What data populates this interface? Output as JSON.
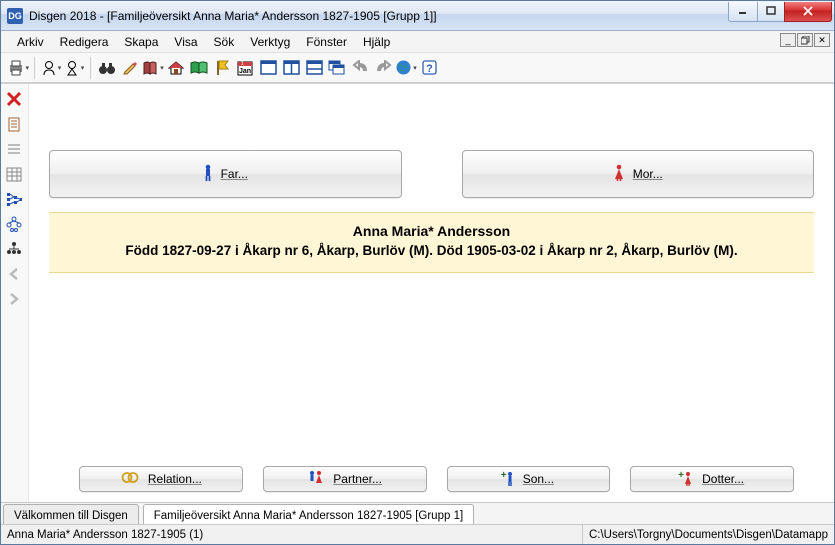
{
  "titlebar": {
    "app_icon": "DG",
    "title": "Disgen 2018 - [Familjeöversikt Anna Maria* Andersson 1827-1905 [Grupp 1]]"
  },
  "menu": {
    "items": [
      "Arkiv",
      "Redigera",
      "Skapa",
      "Visa",
      "Sök",
      "Verktyg",
      "Fönster",
      "Hjälp"
    ]
  },
  "parents": {
    "father_label": "Far...",
    "mother_label": "Mor..."
  },
  "person": {
    "name": "Anna Maria* Andersson",
    "info": "Född 1827-09-27 i Åkarp nr 6, Åkarp, Burlöv (M). Död 1905-03-02 i Åkarp nr 2, Åkarp, Burlöv (M)."
  },
  "actions": {
    "relation": "Relation...",
    "partner": "Partner...",
    "son": "Son...",
    "dotter": "Dotter..."
  },
  "tabs": {
    "welcome": "Välkommen till Disgen",
    "overview": "Familjeöversikt Anna Maria* Andersson 1827-1905 [Grupp 1]"
  },
  "status": {
    "left": "Anna Maria* Andersson 1827-1905 (1)",
    "right": "C:\\Users\\Torgny\\Documents\\Disgen\\Datamapp"
  }
}
